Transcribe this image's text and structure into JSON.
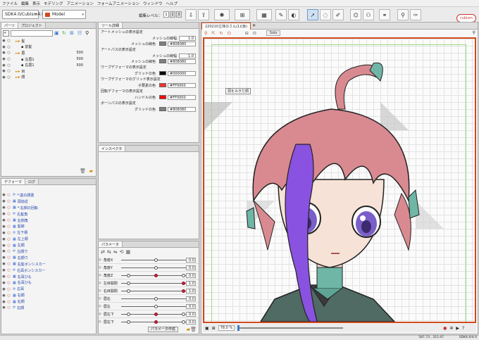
{
  "menu": [
    "ファイル",
    "編集",
    "表示",
    "モデリング",
    "アニメーション",
    "フォームアニメーション",
    "ウィンドウ",
    "ヘルプ"
  ],
  "toolbar": {
    "sdk": "SDK4.0/Cubism4.0",
    "model": "Model",
    "edit_level_label": "編集レベル：",
    "levels": [
      "1",
      "2",
      "3"
    ],
    "brand": "cubism"
  },
  "parts_panel": {
    "tabs": [
      "パーツ",
      "プロジェクト"
    ],
    "rows": [
      {
        "label": "髪",
        "kind": "folder",
        "value": ""
      },
      {
        "label": "前髪",
        "kind": "item",
        "value": ""
      },
      {
        "label": "眉",
        "kind": "folder",
        "value": "500"
      },
      {
        "label": "左眉1",
        "kind": "item",
        "value": "500"
      },
      {
        "label": "右眉1",
        "kind": "item",
        "value": "500"
      },
      {
        "label": "目",
        "kind": "folder",
        "value": ""
      },
      {
        "label": "顔",
        "kind": "folder",
        "value": ""
      }
    ]
  },
  "deformer_panel": {
    "tabs": [
      "デフォーマ",
      "ログ"
    ],
    "rows": [
      "*:基の顔書",
      "頭追従",
      "*:右側の回転",
      "右髪角",
      "右側角",
      "髪跡",
      "左下頬",
      "左上頬",
      "左顔",
      "左顔ウ",
      "右顔ウ",
      "右髪ボンシスカー",
      "右耳ボンシスカー",
      "右耳ひも",
      "右耳ひも",
      "右耳",
      "右顔",
      "右顔",
      "右顔"
    ]
  },
  "tool_settings": {
    "title": "ツール詳細",
    "rows": [
      {
        "type": "section",
        "label": "アートメッシュの表示設定"
      },
      {
        "type": "num",
        "label": "メッシュの線幅",
        "value": "1.0"
      },
      {
        "type": "color",
        "label": "メッシュの線色",
        "value": "#808080",
        "color": "#808080"
      },
      {
        "type": "section",
        "label": "アートパスの表示設定"
      },
      {
        "type": "num",
        "label": "メッシュの線幅",
        "value": "1.0"
      },
      {
        "type": "color",
        "label": "メッシュの線色",
        "value": "#808080",
        "color": "#808080"
      },
      {
        "type": "section",
        "label": "ワープデフォーマの表示設定"
      },
      {
        "type": "color",
        "label": "グリッドの色",
        "value": "#000000",
        "color": "#000000"
      },
      {
        "type": "section",
        "label": "ワープデフォーマのグリッド表示設定"
      },
      {
        "type": "color",
        "label": "子要素の色",
        "value": "#FF0000",
        "color": "#ff3030"
      },
      {
        "type": "section",
        "label": "回転デフォーマの表示設定"
      },
      {
        "type": "color",
        "label": "ハンドルの色",
        "value": "#FF0000",
        "color": "#ff0000"
      },
      {
        "type": "section",
        "label": "ボーンパスの表示設定"
      },
      {
        "type": "color",
        "label": "グリッドの色",
        "value": "#808080",
        "color": "#808080"
      }
    ]
  },
  "inspector": {
    "title": "インスペクタ"
  },
  "parameters": {
    "title": "パラメータ",
    "rows": [
      {
        "label": "角度X",
        "value": "0.0"
      },
      {
        "label": "角度Y",
        "value": "0.0"
      },
      {
        "label": "角度Z",
        "value": "0.0"
      },
      {
        "label": "左目開閉",
        "value": "1.0"
      },
      {
        "label": "右目開閉",
        "value": "1.0"
      },
      {
        "label": "眉右",
        "value": "0.0"
      },
      {
        "label": "眉左",
        "value": "0.0"
      },
      {
        "label": "眉左下",
        "value": "0.0"
      },
      {
        "label": "眉右下",
        "value": "0.0"
      }
    ],
    "footer": "パラメータ作成"
  },
  "viewport": {
    "tab": "220210立体のさん(1)(仮)",
    "solo": "Solo",
    "tooltip": "頭をみきだ顔",
    "zoom": "78.0 %"
  },
  "status": {
    "coords": "587.73 , 315.47",
    "sdk": "SDK4.0/4.0"
  },
  "colors": {
    "accent": "#d14a1e",
    "selection": "#6f9bc8"
  }
}
